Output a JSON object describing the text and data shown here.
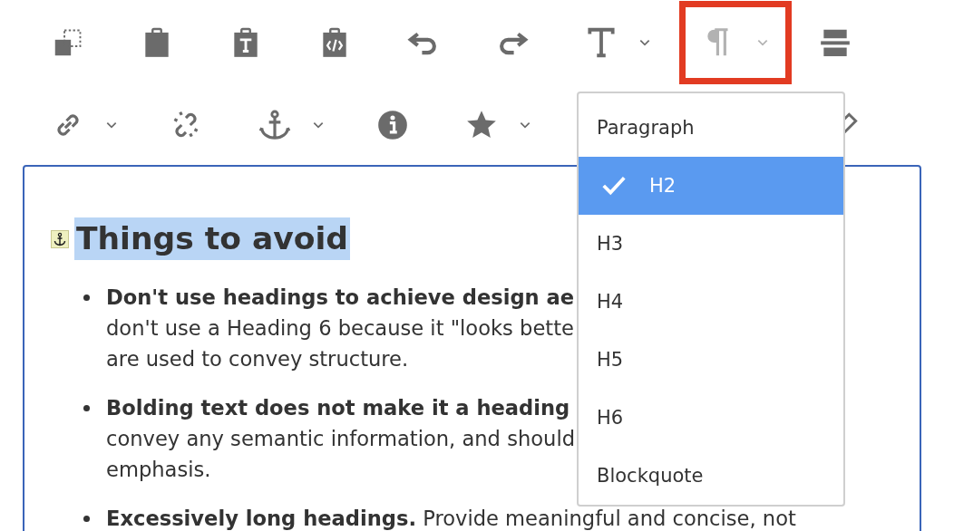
{
  "toolbar": {
    "rows": [
      [
        {
          "kind": "copy",
          "dropdown": false,
          "disabled": false,
          "highlighted": false
        },
        {
          "kind": "paste",
          "dropdown": false,
          "disabled": false,
          "highlighted": false
        },
        {
          "kind": "paste-text",
          "dropdown": false,
          "disabled": false,
          "highlighted": false
        },
        {
          "kind": "paste-code",
          "dropdown": false,
          "disabled": false,
          "highlighted": false
        },
        {
          "kind": "undo",
          "dropdown": false,
          "disabled": false,
          "highlighted": false
        },
        {
          "kind": "redo",
          "dropdown": false,
          "disabled": false,
          "highlighted": false
        },
        {
          "kind": "text-format",
          "dropdown": true,
          "disabled": false,
          "highlighted": false
        },
        {
          "kind": "paragraph",
          "dropdown": true,
          "disabled": true,
          "highlighted": true
        },
        {
          "kind": "rule",
          "dropdown": false,
          "disabled": false,
          "highlighted": false
        }
      ],
      [
        {
          "kind": "link",
          "dropdown": true,
          "disabled": false,
          "highlighted": false
        },
        {
          "kind": "unlink",
          "dropdown": false,
          "disabled": false,
          "highlighted": false
        },
        {
          "kind": "anchor",
          "dropdown": true,
          "disabled": false,
          "highlighted": false
        },
        {
          "kind": "info",
          "dropdown": false,
          "disabled": false,
          "highlighted": false
        },
        {
          "kind": "star",
          "dropdown": true,
          "disabled": false,
          "highlighted": false
        },
        {
          "kind": "pencil",
          "dropdown": false,
          "disabled": false,
          "highlighted": false
        }
      ]
    ]
  },
  "format_menu": {
    "items": [
      {
        "label": "Paragraph",
        "selected": false
      },
      {
        "label": "H2",
        "selected": true
      },
      {
        "label": "H3",
        "selected": false
      },
      {
        "label": "H4",
        "selected": false
      },
      {
        "label": "H5",
        "selected": false
      },
      {
        "label": "H6",
        "selected": false
      },
      {
        "label": "Blockquote",
        "selected": false
      }
    ]
  },
  "editor": {
    "heading": {
      "text": "Things to avoid",
      "selected": true,
      "anchor": true
    },
    "bullets": [
      {
        "lines": [
          "**Don't use headings to achieve design ae**",
          "don't use a Heading 6 because it \"looks bette",
          "are used to convey structure."
        ]
      },
      {
        "lines": [
          "**Bolding text does not make it a heading**",
          "convey any semantic information, and should",
          "emphasis."
        ]
      },
      {
        "lines": [
          "**Excessively long headings.** Provide meaningful and concise, not"
        ]
      }
    ]
  }
}
